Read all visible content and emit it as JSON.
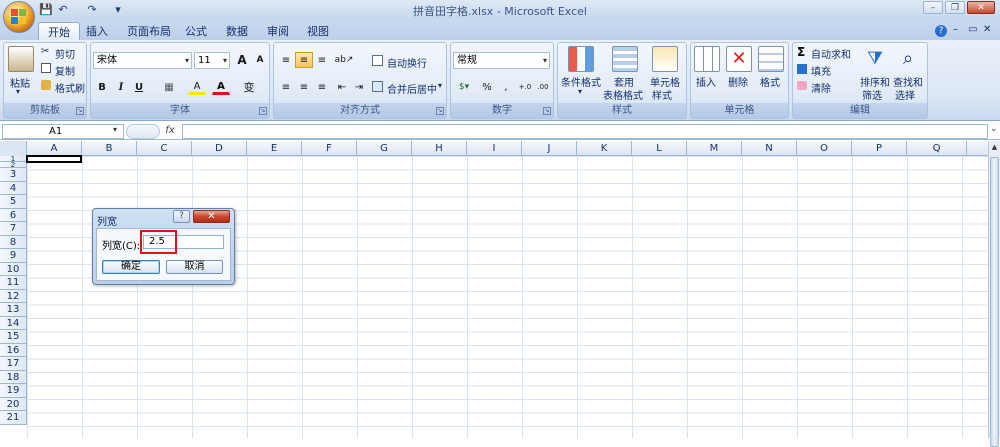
{
  "window": {
    "title": "拼音田字格.xlsx - Microsoft Excel",
    "controls": {
      "minimize": "–",
      "restore": "❐",
      "close": "✕"
    },
    "doc_controls": {
      "minimize": "–",
      "restore": "▭",
      "close": "✕"
    }
  },
  "quick_access": {
    "save": "💾",
    "undo": "↶",
    "redo": "↷",
    "customize": "▾"
  },
  "tabs": [
    {
      "label": "开始",
      "active": true
    },
    {
      "label": "插入"
    },
    {
      "label": "页面布局"
    },
    {
      "label": "公式"
    },
    {
      "label": "数据"
    },
    {
      "label": "审阅"
    },
    {
      "label": "视图"
    }
  ],
  "ribbon_right": {
    "help": "?",
    "minimize": "–",
    "restore": "▭",
    "close": "✕"
  },
  "clipboard": {
    "group_label": "剪贴板",
    "paste": "粘贴",
    "cut": "剪切",
    "copy": "复制",
    "format_painter": "格式刷"
  },
  "font": {
    "group_label": "字体",
    "font_name": "宋体",
    "font_size": "11",
    "grow": "A",
    "shrink": "A",
    "bold": "B",
    "italic": "I",
    "underline": "U",
    "border": "▦",
    "fill": "A",
    "font_color": "A",
    "phonetic": "变"
  },
  "alignment": {
    "group_label": "对齐方式",
    "wrap_text": "自动换行",
    "merge_center": "合并后居中"
  },
  "number": {
    "group_label": "数字",
    "format": "常规",
    "percent": "%",
    "comma": ",",
    "inc_decimal": "+.0",
    "dec_decimal": ".00"
  },
  "styles": {
    "group_label": "样式",
    "conditional": "条件格式",
    "table_format": [
      "套用",
      "表格格式"
    ],
    "cell_styles": [
      "单元格",
      "样式"
    ]
  },
  "cells": {
    "group_label": "单元格",
    "insert": "插入",
    "delete": "删除",
    "format": "格式"
  },
  "editing": {
    "group_label": "编辑",
    "autosum": "自动求和",
    "fill": "填充",
    "clear": "清除",
    "sort_filter": [
      "排序和",
      "筛选"
    ],
    "find_select": [
      "查找和",
      "选择"
    ]
  },
  "formula_bar": {
    "name_box": "A1",
    "fx": "fx",
    "formula": ""
  },
  "sheet": {
    "columns": [
      "A",
      "B",
      "C",
      "D",
      "E",
      "F",
      "G",
      "H",
      "I",
      "J",
      "K",
      "L",
      "M",
      "N",
      "O",
      "P",
      "Q"
    ],
    "rows": [
      "1",
      "2",
      "3",
      "4",
      "5",
      "6",
      "7",
      "8",
      "9",
      "10",
      "11",
      "12",
      "13",
      "14",
      "15",
      "16",
      "17",
      "18",
      "19",
      "20",
      "21"
    ]
  },
  "dialog": {
    "title": "列宽",
    "help": "?",
    "close": "✕",
    "field_label": "列宽(C):",
    "field_value": "2.5",
    "ok": "确定",
    "cancel": "取消"
  },
  "colors": {
    "accent": "#c5d7ee",
    "highlight": "#e0101a"
  }
}
